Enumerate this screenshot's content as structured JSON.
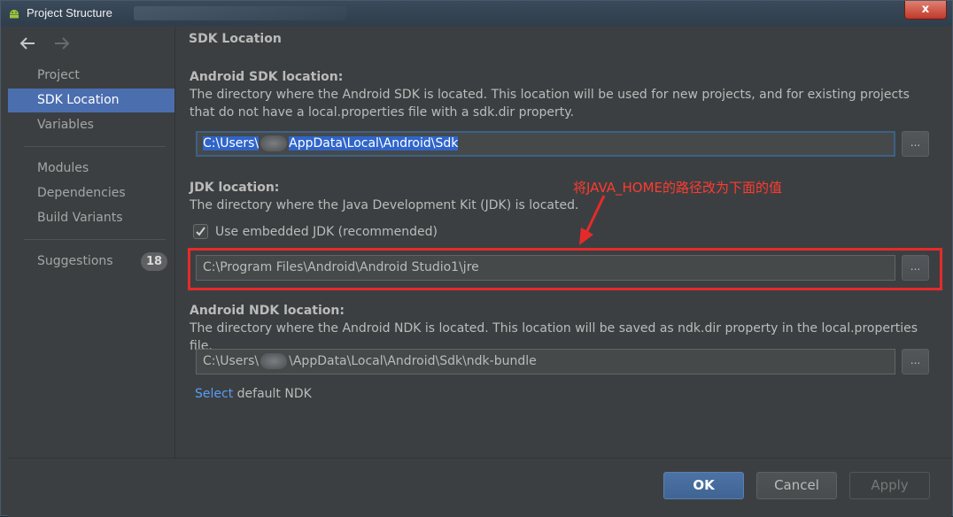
{
  "window": {
    "title": "Project Structure",
    "close_glyph": "x"
  },
  "sidebar": {
    "items": [
      {
        "label": "Project"
      },
      {
        "label": "SDK Location"
      },
      {
        "label": "Variables"
      },
      {
        "label": "Modules"
      },
      {
        "label": "Dependencies"
      },
      {
        "label": "Build Variants"
      },
      {
        "label": "Suggestions",
        "badge": "18"
      }
    ],
    "selected": "SDK Location"
  },
  "content": {
    "section_title": "SDK Location",
    "sdk": {
      "label": "Android SDK location:",
      "desc": "The directory where the Android SDK is located. This location will be used for new projects, and for existing projects that do not have a local.properties file with a sdk.dir property.",
      "path_prefix": "C:\\Users\\",
      "path_suffix": "AppData\\Local\\Android\\Sdk",
      "browse": "..."
    },
    "jdk": {
      "label": "JDK location:",
      "desc": "The directory where the Java Development Kit (JDK) is located.",
      "checkbox_label": "Use embedded JDK (recommended)",
      "checked": true,
      "path": "C:\\Program Files\\Android\\Android Studio1\\jre",
      "browse": "..."
    },
    "ndk": {
      "label": "Android NDK location:",
      "desc": "The directory where the Android NDK is located. This location will be saved as ndk.dir property in the local.properties file.",
      "path_prefix": "C:\\Users\\",
      "path_suffix": "\\AppData\\Local\\Android\\Sdk\\ndk-bundle",
      "browse": "...",
      "select_link": "Select",
      "select_rest": " default NDK"
    },
    "annotation": {
      "text": "将JAVA_HOME的路径改为下面的值",
      "color": "#e62a2a"
    }
  },
  "footer": {
    "ok": "OK",
    "cancel": "Cancel",
    "apply": "Apply"
  },
  "colors": {
    "background": "#3c3f41",
    "selection": "#4b6eaf",
    "link": "#589df6",
    "primary_button": "#4d72a4"
  }
}
